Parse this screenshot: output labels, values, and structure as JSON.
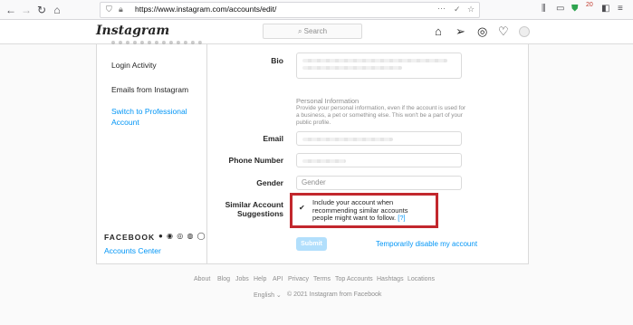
{
  "browser": {
    "back": "←",
    "forward": "→",
    "reload": "↻",
    "home": "⌂",
    "url": "https://www.instagram.com/accounts/edit/",
    "menu_dots": "···",
    "pocket": "✓",
    "star": "☆",
    "library": "|||\\",
    "sidebar": "▭",
    "badge": "20"
  },
  "ig": {
    "logo": "Instagram",
    "search_placeholder": "⌕ Search",
    "nav": {
      "home": "⌂",
      "direct": "➢",
      "explore": "◎",
      "activity": "♡"
    }
  },
  "sidebar": {
    "items": [
      {
        "label": "Login Activity",
        "active": false
      },
      {
        "label": "Emails from Instagram",
        "active": false
      },
      {
        "label": "Switch to Professional",
        "active": true
      },
      {
        "label": "Account",
        "active": true
      }
    ],
    "facebook_title": "FACEBOOK",
    "facebook_icons": "● ◉ ◎ ◍ ◯",
    "accounts_center": "Accounts Center"
  },
  "form": {
    "bio_label": "Bio",
    "personal_info_title": "Personal Information",
    "personal_info_desc": "Provide your personal information, even if the account is used for a business, a pet or something else. This won't be a part of your public profile.",
    "email_label": "Email",
    "phone_label": "Phone Number",
    "gender_label": "Gender",
    "gender_value": "Gender",
    "similar_label": "Similar Account Suggestions",
    "checkbox_text": "Include your account when recommending similar accounts people might want to follow.",
    "checkbox_help": "[?]",
    "checkbox_checked": true,
    "submit": "Submit",
    "disable_link": "Temporarily disable my account"
  },
  "footer": {
    "links": [
      "About",
      "Blog",
      "Jobs",
      "Help",
      "API",
      "Privacy",
      "Terms",
      "Top Accounts",
      "Hashtags",
      "Locations"
    ],
    "language": "English ⌄",
    "copyright": "© 2021 Instagram from Facebook"
  }
}
